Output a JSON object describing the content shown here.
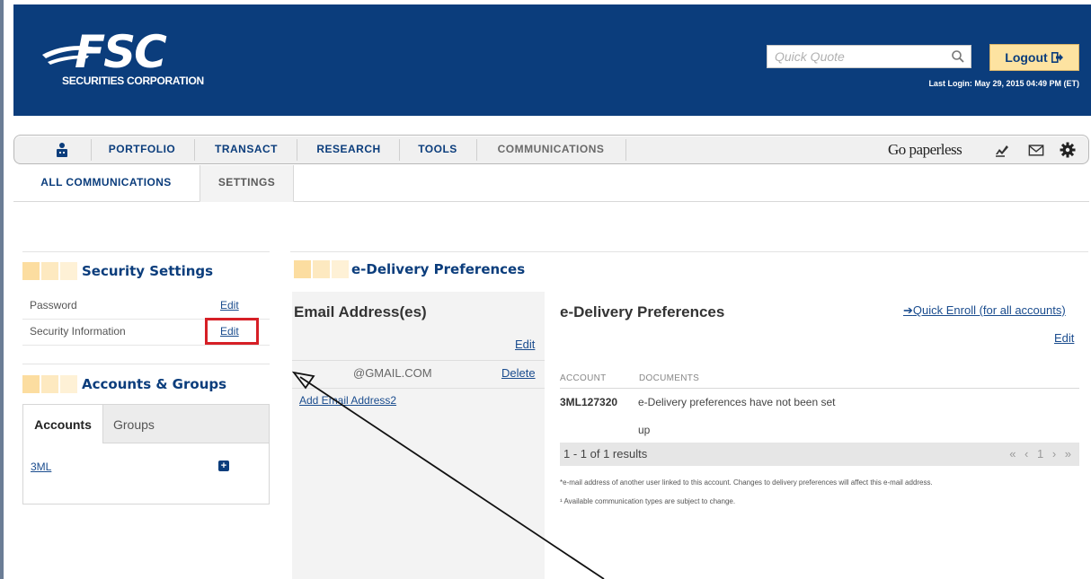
{
  "header": {
    "logo_main": "FSC",
    "logo_sub": "SECURITIES CORPORATION",
    "quick_quote_placeholder": "Quick Quote",
    "logout_label": "Logout",
    "last_login": "Last Login: May 29, 2015 04:49 PM (ET)"
  },
  "nav": {
    "items": [
      "PORTFOLIO",
      "TRANSACT",
      "RESEARCH",
      "TOOLS",
      "COMMUNICATIONS"
    ],
    "go_paperless": "Go paperless"
  },
  "subtabs": {
    "all": "ALL COMMUNICATIONS",
    "settings": "SETTINGS"
  },
  "security": {
    "title": "Security Settings",
    "rows": [
      {
        "label": "Password",
        "action": "Edit"
      },
      {
        "label": "Security Information",
        "action": "Edit"
      }
    ]
  },
  "accounts": {
    "title": "Accounts & Groups",
    "tabs": [
      "Accounts",
      "Groups"
    ],
    "items": [
      {
        "label": "3ML",
        "action": "+"
      }
    ]
  },
  "edelivery": {
    "title": "e-Delivery Preferences",
    "email_panel": {
      "title": "Email Address(es)",
      "edit": "Edit",
      "address": "@GMAIL.COM",
      "delete": "Delete",
      "add": "Add Email Address2"
    },
    "prefs": {
      "title": "e-Delivery Preferences",
      "quick_enroll": "Quick Enroll (for all accounts)",
      "edit": "Edit",
      "col_account": "ACCOUNT",
      "col_documents": "DOCUMENTS",
      "account_number": "3ML127320",
      "doc_line1": "e-Delivery preferences have not been set",
      "doc_line2": "up",
      "results": "1 - 1 of 1 results",
      "pager": "« ‹ 1 › »",
      "footnote1": "*e-mail address of another user linked to this account. Changes to delivery preferences will affect this e-mail address.",
      "footnote2": "¹ Available communication types are subject to change."
    }
  }
}
